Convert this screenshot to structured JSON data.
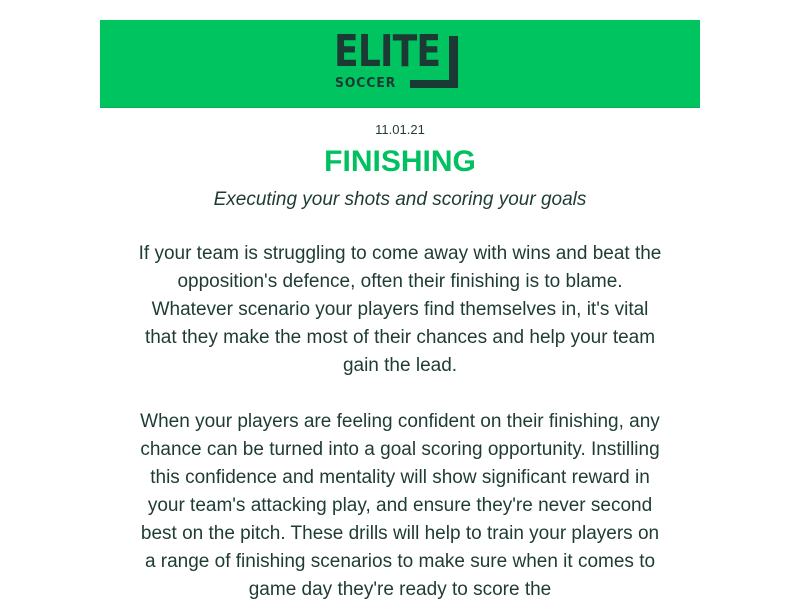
{
  "logo": {
    "wordmark_top": "ELITE",
    "wordmark_bottom": "SOCCER"
  },
  "newsletter": {
    "date": "11.01.21",
    "title": "FINISHING",
    "subtitle": "Executing your shots and scoring your goals",
    "paragraphs": [
      "If your team is struggling to come away with wins and beat the opposition's defence, often their finishing is to blame. Whatever scenario your players find themselves in, it's vital that they make the most of their chances and help your team gain the lead.",
      "When your players are feeling confident on their finishing, any chance can be turned into a goal scoring opportunity. Instilling this confidence and mentality will show significant reward in your team's attacking play, and ensure they're never second best on the pitch. These drills will help to train your players on a range of finishing scenarios to make sure when it comes to game day they're ready to score the"
    ]
  },
  "colors": {
    "brand_green": "#00c460",
    "title_green": "#00c060",
    "logo_dark": "#1a3a33",
    "text_dark": "#1f3b35"
  }
}
